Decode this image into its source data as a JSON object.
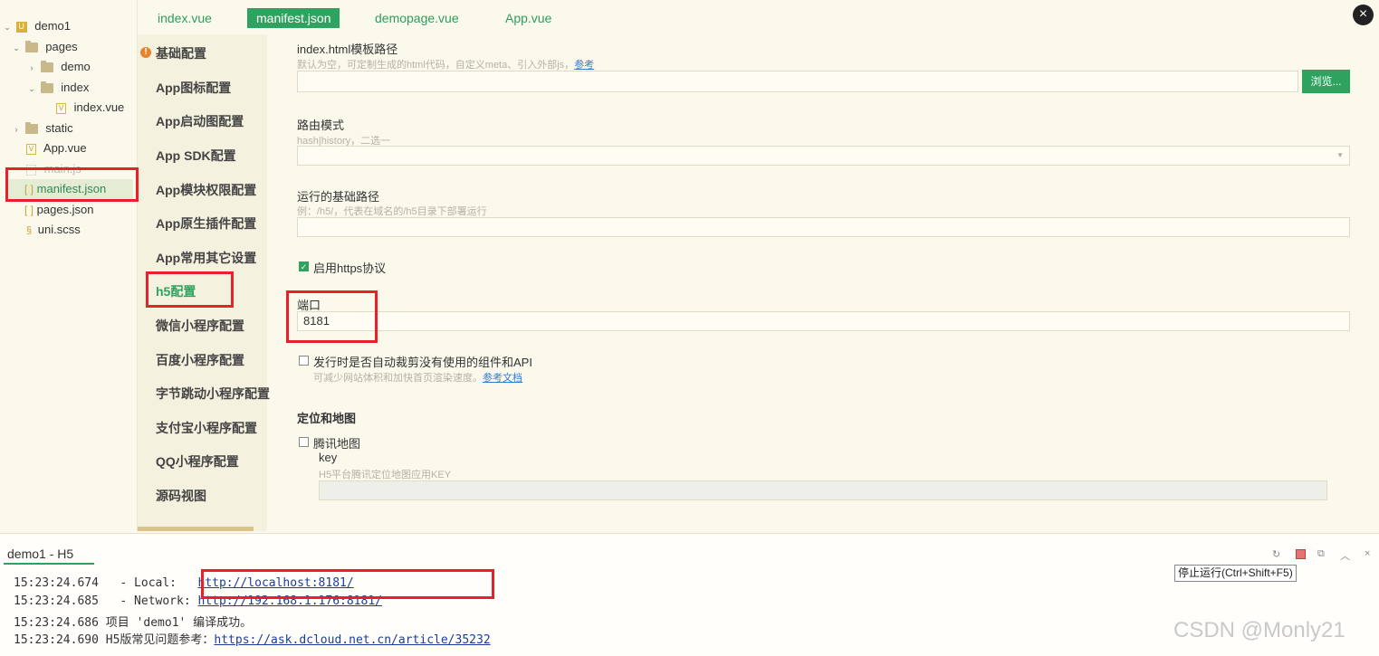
{
  "tree": {
    "items": [
      {
        "label": "demo1",
        "chev": "⌄"
      },
      {
        "label": "pages",
        "chev": "⌄"
      },
      {
        "label": "demo",
        "chev": "›"
      },
      {
        "label": "index",
        "chev": "⌄"
      },
      {
        "label": "index.vue",
        "chev": ""
      },
      {
        "label": "static",
        "chev": "›"
      },
      {
        "label": "App.vue",
        "chev": ""
      },
      {
        "label": "main.js",
        "chev": ""
      },
      {
        "label": "manifest.json",
        "chev": ""
      },
      {
        "label": "pages.json",
        "chev": ""
      },
      {
        "label": "uni.scss",
        "chev": ""
      }
    ]
  },
  "tabs": [
    "index.vue",
    "manifest.json",
    "demopage.vue",
    "App.vue"
  ],
  "close_glyph": "×",
  "nav": {
    "warn_glyph": "!",
    "items": [
      "基础配置",
      "App图标配置",
      "App启动图配置",
      "App SDK配置",
      "App模块权限配置",
      "App原生插件配置",
      "App常用其它设置",
      "h5配置",
      "微信小程序配置",
      "百度小程序配置",
      "字节跳动小程序配置",
      "支付宝小程序配置",
      "QQ小程序配置",
      "源码视图"
    ]
  },
  "form": {
    "template_label": "index.html模板路径",
    "template_hint": "默认为空，可定制生成的html代码，自定义meta、引入外部js，",
    "template_hint_link": "参考",
    "template_value": "",
    "browse_label": "浏览...",
    "router_label": "路由模式",
    "router_hint": "hash|history，二选一",
    "router_value": "",
    "base_label": "运行的基础路径",
    "base_hint": "例：/h5/，代表在域名的/h5目录下部署运行",
    "base_value": "",
    "https_label": "启用https协议",
    "https_checked": true,
    "port_label": "端口",
    "port_value": "8181",
    "treeshake_label": "发行时是否自动裁剪没有使用的组件和API",
    "treeshake_hint": "可减少网站体积和加快首页渲染速度。",
    "treeshake_hint_link": "参考文档",
    "section_title": "定位和地图",
    "tencent_label": "腾讯地图",
    "key_label": "key",
    "key_hint": "H5平台腾讯定位地图应用KEY",
    "key_value": ""
  },
  "console": {
    "tab_label": "demo1 - H5",
    "tooltip": "停止运行(Ctrl+Shift+F5)",
    "lines": [
      {
        "prefix": "15:23:24.674   - Local:   ",
        "link": "http://localhost:8181/"
      },
      {
        "prefix": "15:23:24.685   - Network: ",
        "link": "http://192.168.1.176:8181/"
      },
      {
        "prefix": "15:23:24.686 项目 'demo1' 编译成功。",
        "link": ""
      },
      {
        "prefix": "15:23:24.690 H5版常见问题参考：",
        "link": "https://ask.dcloud.net.cn/article/35232"
      }
    ]
  },
  "watermark": "CSDN @Monly21",
  "colors": {
    "accent": "#2ea35f",
    "highlight": "#e8202a"
  }
}
